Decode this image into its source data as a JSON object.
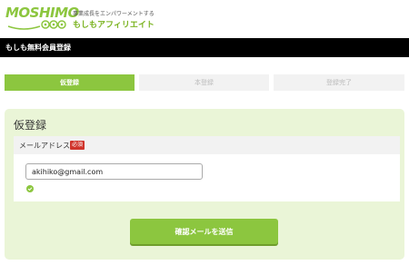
{
  "header": {
    "logo_text": "MOSHIMO",
    "tagline": "事業成長をエンパワーメントする",
    "brand_sub": "もしもアフィリエイト"
  },
  "page_bar": {
    "title": "もしも無料会員登録"
  },
  "steps": [
    {
      "label": "仮登録",
      "state": "active"
    },
    {
      "label": "本登録",
      "state": "inactive"
    },
    {
      "label": "登録完了",
      "state": "inactive"
    }
  ],
  "form": {
    "title": "仮登録",
    "email_label": "メールアドレス",
    "required_badge": "必須",
    "email_value": "akihiko@gmail.com",
    "valid_icon": "check-circle-icon",
    "submit_label": "確認メールを送信"
  },
  "colors": {
    "accent": "#8cc63f",
    "card_bg": "#eaf5d7",
    "required": "#d0342c",
    "bar": "#000000"
  }
}
